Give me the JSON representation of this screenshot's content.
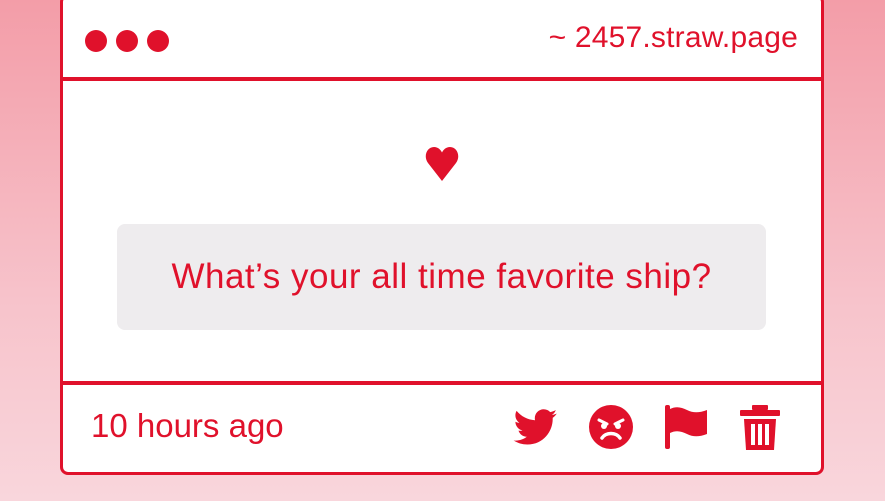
{
  "window": {
    "url": "~ 2457.straw.page",
    "dots": [
      "dot",
      "dot",
      "dot"
    ]
  },
  "post": {
    "heart_icon": "heart-icon",
    "question": "What’s your all time favorite ship?",
    "timestamp": "10 hours ago"
  },
  "actions": [
    {
      "name": "twitter-share",
      "icon": "twitter-icon"
    },
    {
      "name": "angry-reaction",
      "icon": "angry-face-icon"
    },
    {
      "name": "report",
      "icon": "flag-icon"
    },
    {
      "name": "delete",
      "icon": "trash-icon"
    }
  ],
  "colors": {
    "accent": "#e0112b",
    "background_top": "#f39da8",
    "background_bottom": "#f9d6dc",
    "question_bg": "#eeecee",
    "card_bg": "#ffffff"
  }
}
